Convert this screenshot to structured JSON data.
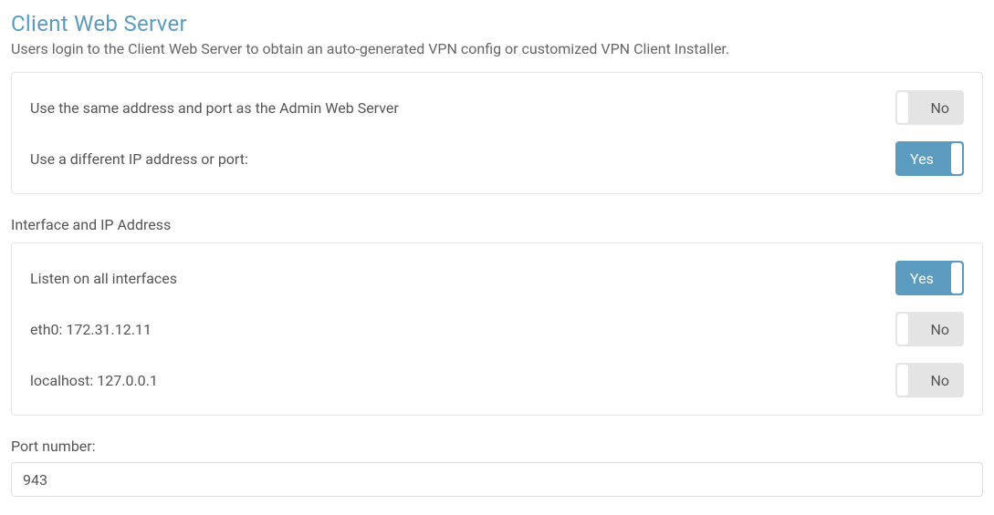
{
  "header": {
    "title": "Client Web Server",
    "description": "Users login to the Client Web Server to obtain an auto-generated VPN config or customized VPN Client Installer."
  },
  "address_panel": {
    "rows": [
      {
        "label": "Use the same address and port as the Admin Web Server",
        "state": "off",
        "text": "No"
      },
      {
        "label": "Use a different IP address or port:",
        "state": "on",
        "text": "Yes"
      }
    ]
  },
  "interface_section": {
    "heading": "Interface and IP Address",
    "rows": [
      {
        "label": "Listen on all interfaces",
        "state": "on",
        "text": "Yes"
      },
      {
        "label": "eth0: 172.31.12.11",
        "state": "off",
        "text": "No"
      },
      {
        "label": "localhost: 127.0.0.1",
        "state": "off",
        "text": "No"
      }
    ]
  },
  "port": {
    "label": "Port number:",
    "value": "943"
  }
}
